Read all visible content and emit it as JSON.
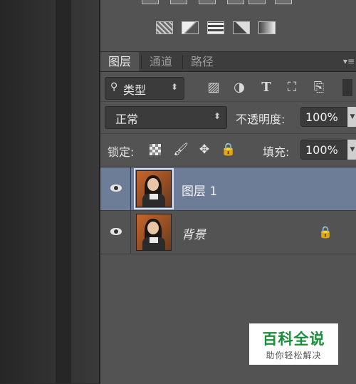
{
  "tabs": [
    {
      "label": "图层",
      "active": true
    },
    {
      "label": "通道",
      "active": false
    },
    {
      "label": "路径",
      "active": false
    }
  ],
  "filter": {
    "label": "类型",
    "search_icon": "search-icon"
  },
  "blend": {
    "mode": "正常",
    "opacity_label": "不透明度:",
    "opacity_value": "100%"
  },
  "lock": {
    "label": "锁定:",
    "fill_label": "填充:",
    "fill_value": "100%"
  },
  "layers": [
    {
      "name": "图层 1",
      "selected": true,
      "visible": true,
      "locked": false
    },
    {
      "name": "背景",
      "selected": false,
      "visible": true,
      "locked": true
    }
  ],
  "watermark": {
    "title": "百科全说",
    "subtitle": "助你轻松解决"
  },
  "colors": {
    "panel": "#535353",
    "selected_row": "#6d7d98",
    "tab_bar": "#3d3d3d",
    "watermark_green": "#1c8d3a"
  }
}
